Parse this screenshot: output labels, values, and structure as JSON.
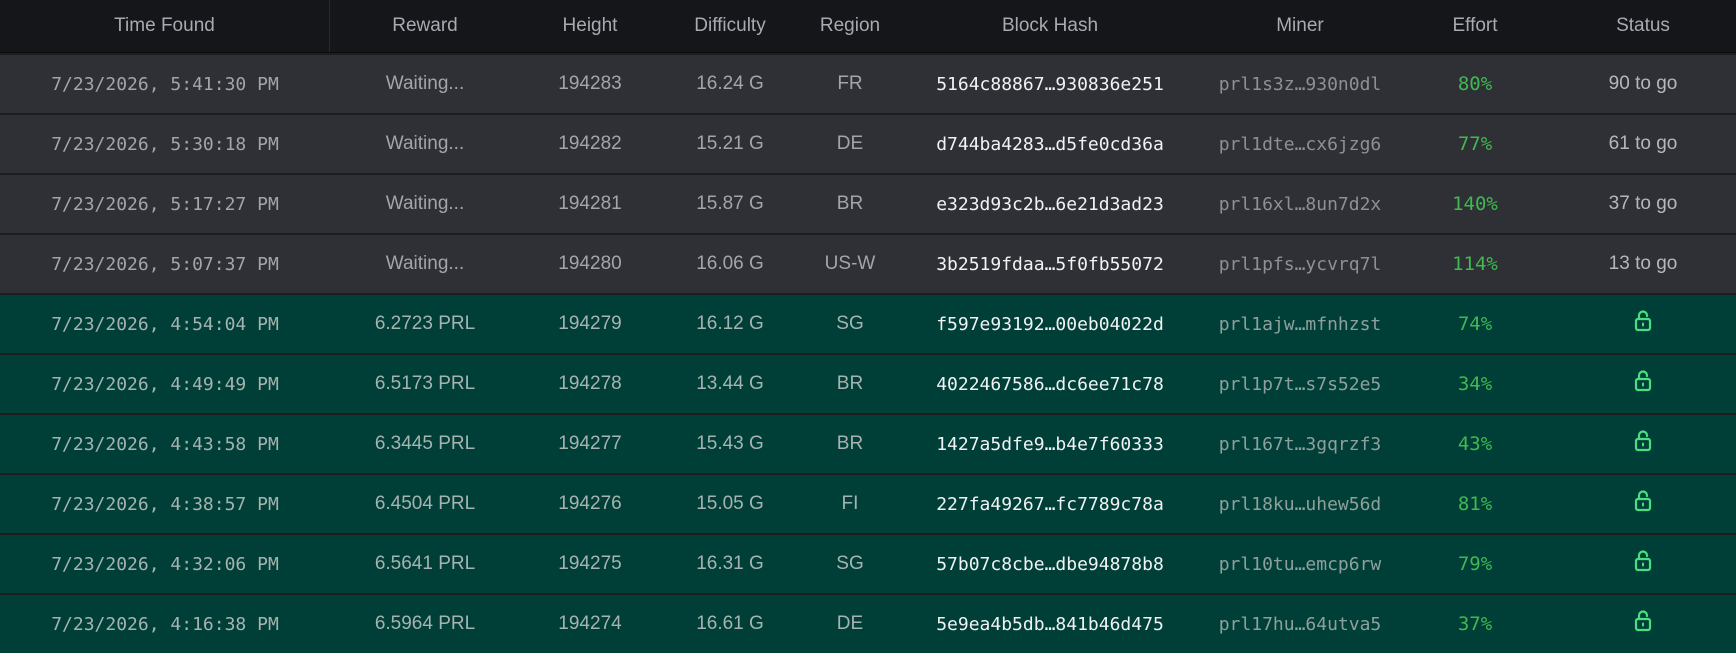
{
  "columns": [
    "Time Found",
    "Reward",
    "Height",
    "Difficulty",
    "Region",
    "Block Hash",
    "Miner",
    "Effort",
    "Status"
  ],
  "colors": {
    "pending_row": "#2e3035",
    "confirmed_row": "#003f37",
    "effort_green": "#3fb950",
    "lock_green": "#4ade80"
  },
  "rows": [
    {
      "time": "7/23/2026, 5:41:30 PM",
      "reward": "Waiting...",
      "height": "194283",
      "difficulty": "16.24 G",
      "region": "FR",
      "hash": "5164c88867…930836e251",
      "miner": "prl1s3z…930n0dl",
      "effort": "80%",
      "status": "90 to go",
      "state": "pending"
    },
    {
      "time": "7/23/2026, 5:30:18 PM",
      "reward": "Waiting...",
      "height": "194282",
      "difficulty": "15.21 G",
      "region": "DE",
      "hash": "d744ba4283…d5fe0cd36a",
      "miner": "prl1dte…cx6jzg6",
      "effort": "77%",
      "status": "61 to go",
      "state": "pending"
    },
    {
      "time": "7/23/2026, 5:17:27 PM",
      "reward": "Waiting...",
      "height": "194281",
      "difficulty": "15.87 G",
      "region": "BR",
      "hash": "e323d93c2b…6e21d3ad23",
      "miner": "prl16xl…8un7d2x",
      "effort": "140%",
      "status": "37 to go",
      "state": "pending"
    },
    {
      "time": "7/23/2026, 5:07:37 PM",
      "reward": "Waiting...",
      "height": "194280",
      "difficulty": "16.06 G",
      "region": "US-W",
      "hash": "3b2519fdaa…5f0fb55072",
      "miner": "prl1pfs…ycvrq7l",
      "effort": "114%",
      "status": "13 to go",
      "state": "pending"
    },
    {
      "time": "7/23/2026, 4:54:04 PM",
      "reward": "6.2723 PRL",
      "height": "194279",
      "difficulty": "16.12 G",
      "region": "SG",
      "hash": "f597e93192…00eb04022d",
      "miner": "prl1ajw…mfnhzst",
      "effort": "74%",
      "status": "unlock-icon",
      "state": "confirmed"
    },
    {
      "time": "7/23/2026, 4:49:49 PM",
      "reward": "6.5173 PRL",
      "height": "194278",
      "difficulty": "13.44 G",
      "region": "BR",
      "hash": "4022467586…dc6ee71c78",
      "miner": "prl1p7t…s7s52e5",
      "effort": "34%",
      "status": "unlock-icon",
      "state": "confirmed"
    },
    {
      "time": "7/23/2026, 4:43:58 PM",
      "reward": "6.3445 PRL",
      "height": "194277",
      "difficulty": "15.43 G",
      "region": "BR",
      "hash": "1427a5dfe9…b4e7f60333",
      "miner": "prl167t…3gqrzf3",
      "effort": "43%",
      "status": "unlock-icon",
      "state": "confirmed"
    },
    {
      "time": "7/23/2026, 4:38:57 PM",
      "reward": "6.4504 PRL",
      "height": "194276",
      "difficulty": "15.05 G",
      "region": "FI",
      "hash": "227fa49267…fc7789c78a",
      "miner": "prl18ku…uhew56d",
      "effort": "81%",
      "status": "unlock-icon",
      "state": "confirmed"
    },
    {
      "time": "7/23/2026, 4:32:06 PM",
      "reward": "6.5641 PRL",
      "height": "194275",
      "difficulty": "16.31 G",
      "region": "SG",
      "hash": "57b07c8cbe…dbe94878b8",
      "miner": "prl10tu…emcp6rw",
      "effort": "79%",
      "status": "unlock-icon",
      "state": "confirmed"
    },
    {
      "time": "7/23/2026, 4:16:38 PM",
      "reward": "6.5964 PRL",
      "height": "194274",
      "difficulty": "16.61 G",
      "region": "DE",
      "hash": "5e9ea4b5db…841b46d475",
      "miner": "prl17hu…64utva5",
      "effort": "37%",
      "status": "unlock-icon",
      "state": "confirmed"
    }
  ]
}
